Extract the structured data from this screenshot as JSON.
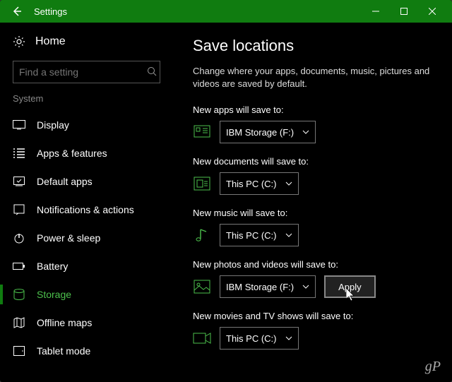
{
  "titlebar": {
    "title": "Settings"
  },
  "sidebar": {
    "home": "Home",
    "search_placeholder": "Find a setting",
    "section": "System",
    "items": [
      {
        "label": "Display"
      },
      {
        "label": "Apps & features"
      },
      {
        "label": "Default apps"
      },
      {
        "label": "Notifications & actions"
      },
      {
        "label": "Power & sleep"
      },
      {
        "label": "Battery"
      },
      {
        "label": "Storage"
      },
      {
        "label": "Offline maps"
      },
      {
        "label": "Tablet mode"
      }
    ]
  },
  "page": {
    "title": "Save locations",
    "description": "Change where your apps, documents, music, pictures and videos are saved by default.",
    "settings": [
      {
        "label": "New apps will save to:",
        "value": "IBM Storage (F:)"
      },
      {
        "label": "New documents will save to:",
        "value": "This PC (C:)"
      },
      {
        "label": "New music will save to:",
        "value": "This PC (C:)"
      },
      {
        "label": "New photos and videos will save to:",
        "value": "IBM Storage (F:)"
      },
      {
        "label": "New movies and TV shows will save to:",
        "value": "This PC (C:)"
      }
    ],
    "apply": "Apply"
  },
  "watermark": "gP"
}
